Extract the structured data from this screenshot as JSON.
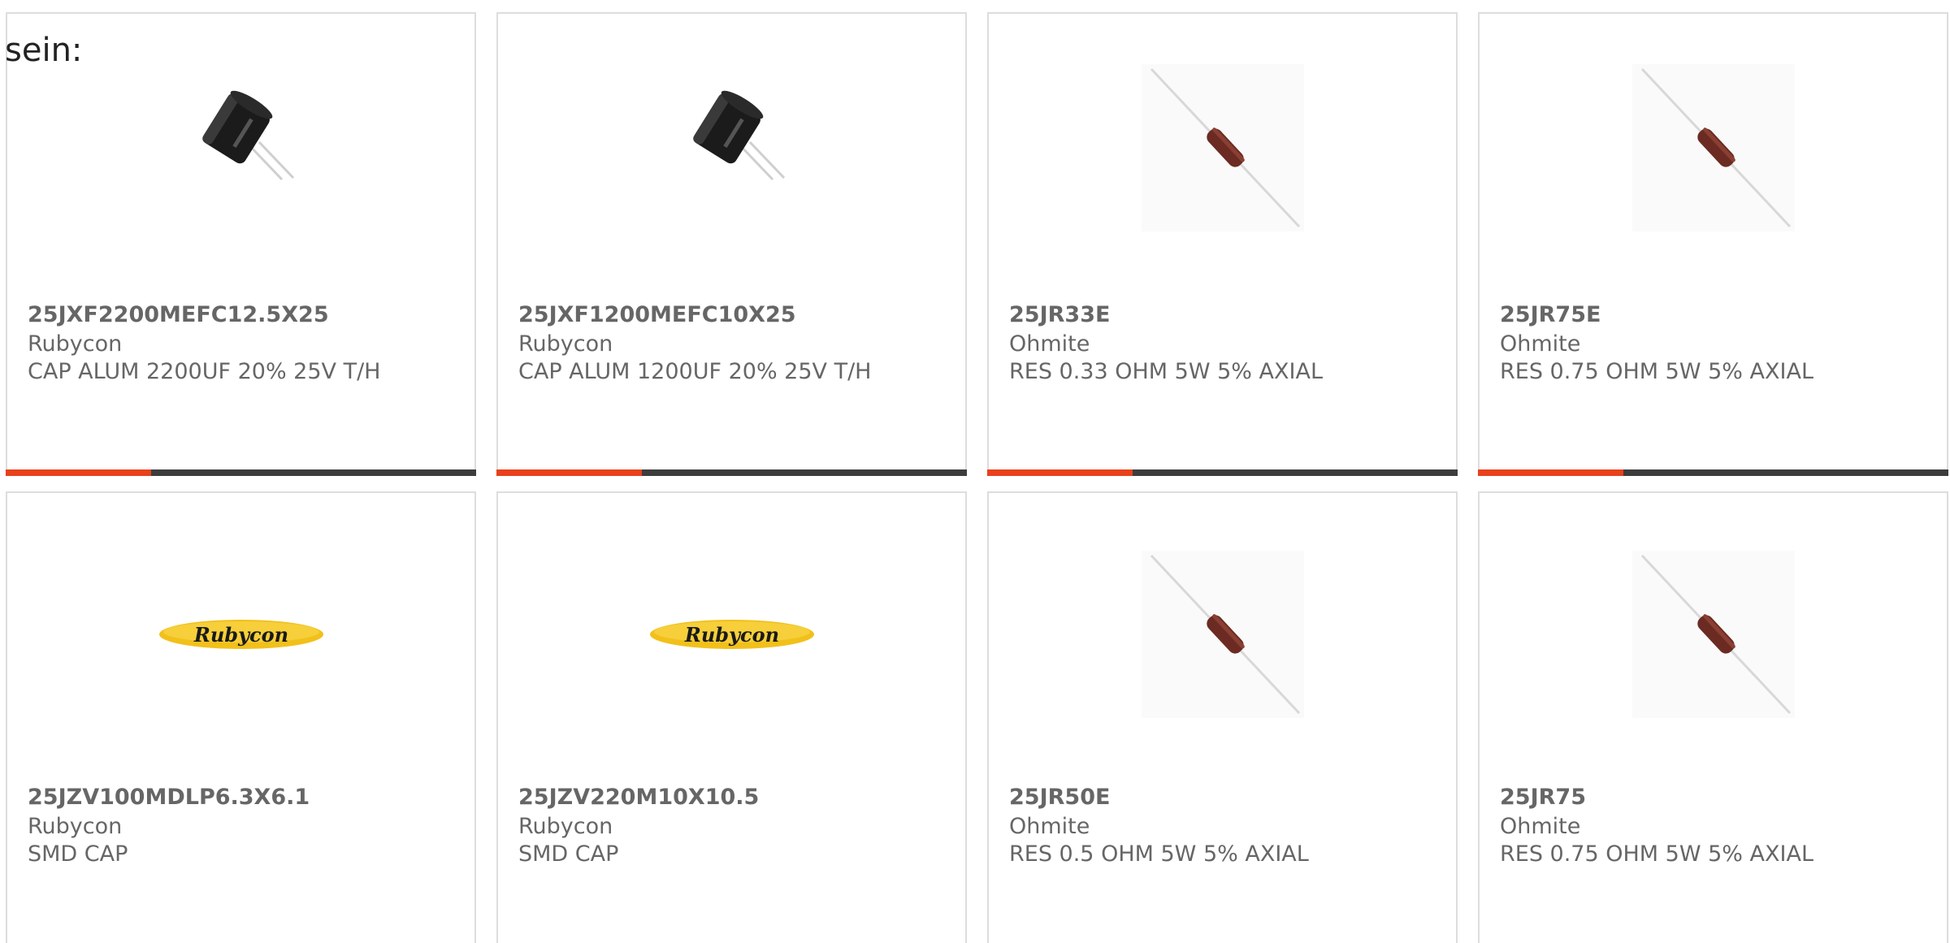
{
  "prefix": "sein:",
  "colors": {
    "accent_bar": "#e8411c",
    "track_bar": "#3d3d3d",
    "card_border": "#dddddd",
    "text": "#666666",
    "rubycon_logo_bg": "#f2c01b",
    "rubycon_logo_text": "#1a1a1a",
    "resistor_body": "#6b2b22"
  },
  "products": [
    {
      "part_number": "25JXF2200MEFC12.5X25",
      "manufacturer": "Rubycon",
      "description": "CAP ALUM 2200UF 20% 25V T/H",
      "image": "capacitor-icon",
      "progress": 0.31
    },
    {
      "part_number": "25JXF1200MEFC10X25",
      "manufacturer": "Rubycon",
      "description": "CAP ALUM 1200UF 20% 25V T/H",
      "image": "capacitor-icon",
      "progress": 0.31
    },
    {
      "part_number": "25JR33E",
      "manufacturer": "Ohmite",
      "description": "RES 0.33 OHM 5W 5% AXIAL",
      "image": "resistor-icon",
      "progress": 0.31
    },
    {
      "part_number": "25JR75E",
      "manufacturer": "Ohmite",
      "description": "RES 0.75 OHM 5W 5% AXIAL",
      "image": "resistor-icon",
      "progress": 0.31
    },
    {
      "part_number": "25JZV100MDLP6.3X6.1",
      "manufacturer": "Rubycon",
      "description": "SMD CAP",
      "image": "rubycon-logo",
      "logo_text": "Rubycon"
    },
    {
      "part_number": "25JZV220M10X10.5",
      "manufacturer": "Rubycon",
      "description": "SMD CAP",
      "image": "rubycon-logo",
      "logo_text": "Rubycon"
    },
    {
      "part_number": "25JR50E",
      "manufacturer": "Ohmite",
      "description": "RES 0.5 OHM 5W 5% AXIAL",
      "image": "resistor-icon"
    },
    {
      "part_number": "25JR75",
      "manufacturer": "Ohmite",
      "description": "RES 0.75 OHM 5W 5% AXIAL",
      "image": "resistor-icon"
    }
  ]
}
